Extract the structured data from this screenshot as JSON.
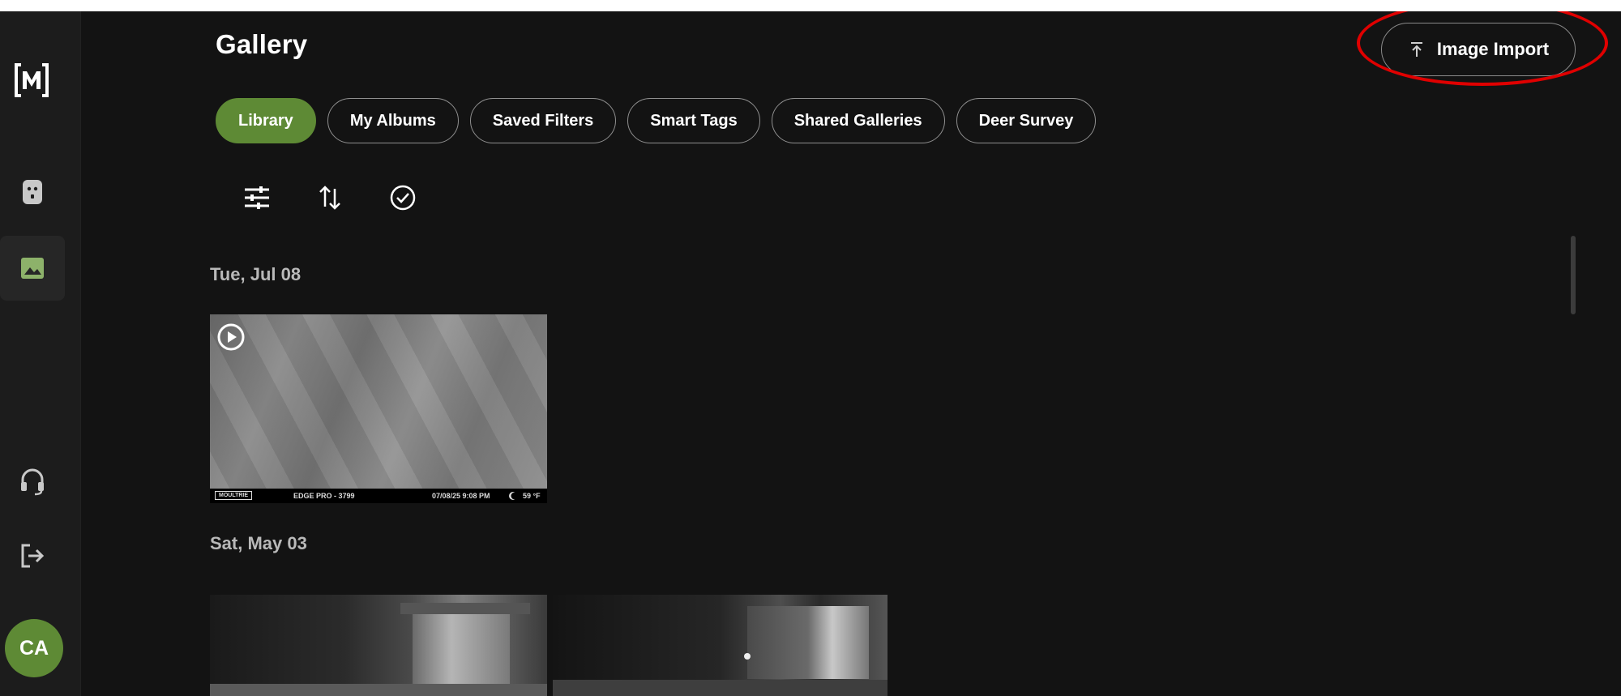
{
  "page": {
    "title": "Gallery"
  },
  "header": {
    "import_label": "Image Import"
  },
  "tabs": [
    {
      "label": "Library",
      "active": true
    },
    {
      "label": "My Albums",
      "active": false
    },
    {
      "label": "Saved Filters",
      "active": false
    },
    {
      "label": "Smart Tags",
      "active": false
    },
    {
      "label": "Shared Galleries",
      "active": false
    },
    {
      "label": "Deer Survey",
      "active": false
    }
  ],
  "toolbar": {
    "icons": [
      "filter-sliders-icon",
      "sort-icon",
      "select-check-icon"
    ]
  },
  "sidebar": {
    "icons": [
      "logo-icon",
      "camera-device-icon",
      "gallery-icon",
      "support-headset-icon",
      "logout-icon"
    ],
    "avatar_initials": "CA"
  },
  "sections": [
    {
      "date": "Tue, Jul 08",
      "items": [
        {
          "type": "video",
          "brand": "MOULTRIE",
          "camera": "EDGE PRO - 3799",
          "timestamp": "07/08/25 9:08 PM",
          "temperature": "59 °F"
        }
      ]
    },
    {
      "date": "Sat, May 03",
      "items": [
        {
          "type": "image"
        },
        {
          "type": "image"
        }
      ]
    }
  ],
  "colors": {
    "accent": "#5e8a35",
    "background": "#131313",
    "sidebar": "#1c1c1c",
    "highlight": "#e00000"
  }
}
